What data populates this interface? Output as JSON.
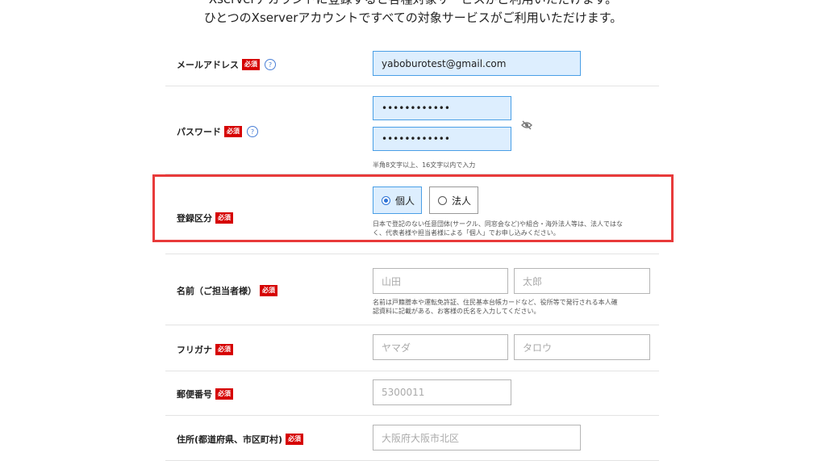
{
  "header": {
    "cut_line": "Xserverアカウントに登録すると各種対象サービスがご利用いただけます。",
    "main_line": "ひとつのXserverアカウントですべての対象サービスがご利用いただけます。"
  },
  "required_badge": "必須",
  "help_icon": "?",
  "email": {
    "label": "メールアドレス",
    "value": "yaboburotest@gmail.com"
  },
  "password": {
    "label": "パスワード",
    "value": "••••••••••••",
    "confirm_value": "••••••••••••",
    "hint": "半角8文字以上、16文字以内で入力",
    "visibility_icon": "eye-slash-icon"
  },
  "registration_type": {
    "label": "登録区分",
    "options": [
      {
        "label": "個人",
        "selected": true
      },
      {
        "label": "法人",
        "selected": false
      }
    ],
    "hint_line1": "日本で登記のない任意団体(サークル、同窓会など)や組合・海外法人等は、法人ではな",
    "hint_line2": "く、代表者様や担当者様による「個人」でお申し込みください。"
  },
  "name": {
    "label": "名前（ご担当者様）",
    "last_placeholder": "山田",
    "first_placeholder": "太郎",
    "hint_line1": "名前は戸籍謄本や運転免許証、住民基本台帳カードなど、役所等で発行される本人確",
    "hint_line2": "認資料に記載がある、お客様の氏名を入力してください。"
  },
  "furigana": {
    "label": "フリガナ",
    "last_placeholder": "ヤマダ",
    "first_placeholder": "タロウ"
  },
  "postal": {
    "label": "郵便番号",
    "placeholder": "5300011"
  },
  "address": {
    "label": "住所(都道府県、市区町村)",
    "placeholder": "大阪府大阪市北区"
  },
  "colors": {
    "required": "#d60000",
    "highlight": "#e83a3a",
    "filled": "#ddeefe",
    "focus_border": "#4a9fe6"
  }
}
